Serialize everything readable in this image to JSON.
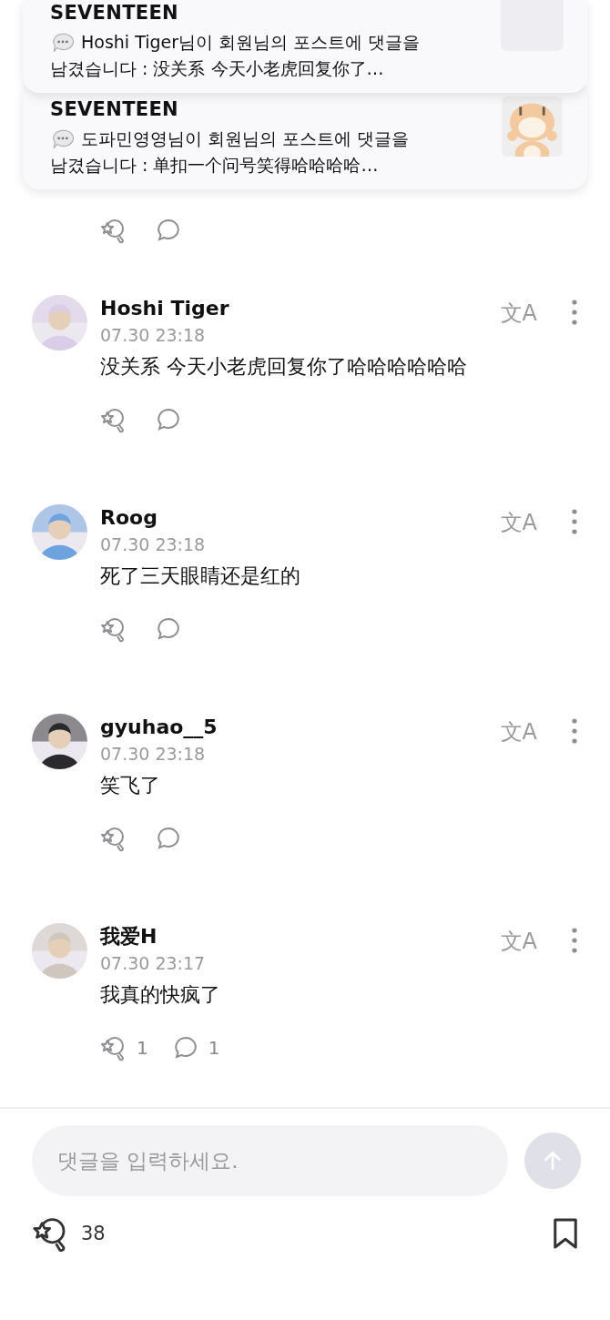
{
  "notifications": [
    {
      "title": "SEVENTEEN",
      "lines": [
        "Hoshi Tiger님이 회원님의 포스트에 댓글을",
        "남겼습니다 : 没关系 今天小老虎回复你了…"
      ],
      "thumbnail": {
        "kind": "blank"
      }
    },
    {
      "title": "SEVENTEEN",
      "lines": [
        "도파민영영님이 회원님의 포스트에 댓글을",
        "남겼습니다 : 单扣一个问号笑得哈哈哈哈…"
      ]
    }
  ],
  "comments": [
    {
      "name": "Hoshi Tiger",
      "time": "07.30 23:18",
      "text": "没关系 今天小老虎回复你了哈哈哈哈哈哈",
      "translate": "文A"
    },
    {
      "name": "Roog",
      "time": "07.30 23:18",
      "text": "死了三天眼睛还是红的",
      "translate": "文A"
    },
    {
      "name": "gyuhao__5",
      "time": "07.30 23:18",
      "text": "笑飞了",
      "translate": "文A"
    },
    {
      "name": "我爱H",
      "time": "07.30 23:17",
      "text": "我真的快疯了",
      "translate": "文A",
      "reactions": "1",
      "replies": "1"
    }
  ],
  "composer": {
    "placeholder": "댓글을 입력하세요.",
    "send_disabled": true
  },
  "footer": {
    "reactions": "38",
    "bookmarked": false
  }
}
